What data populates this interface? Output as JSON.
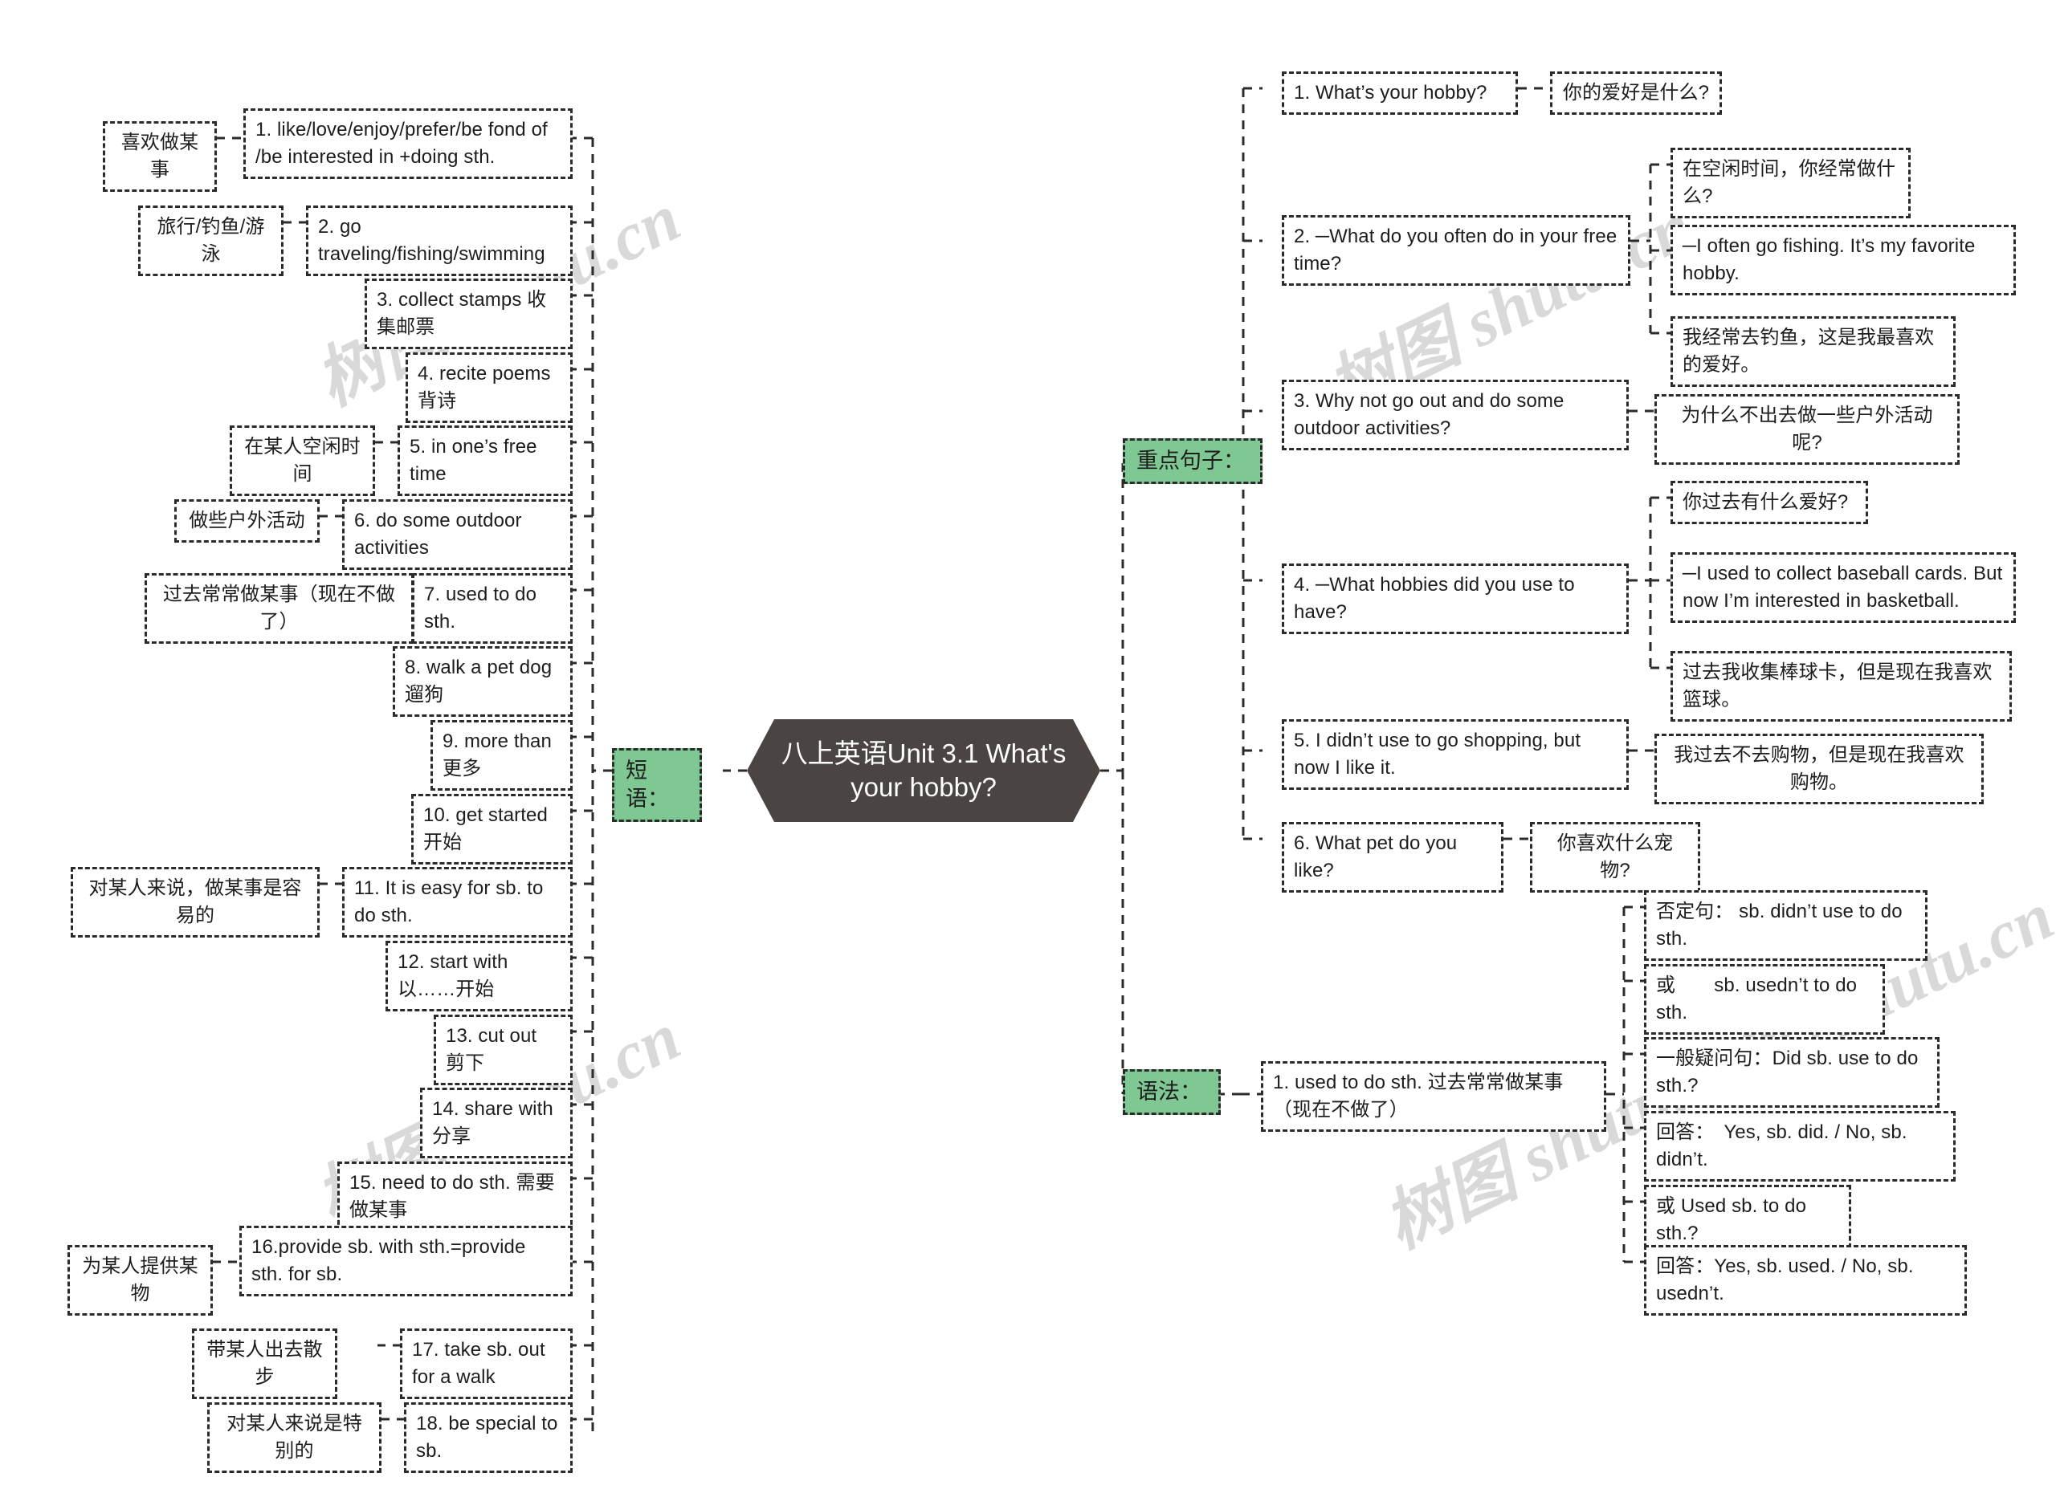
{
  "root": {
    "title": "八上英语Unit 3.1 What's your hobby?"
  },
  "watermarks": [
    "树图 shutu.cn",
    "树图 shutu.cn",
    "树图 shutu.cn",
    "树图 shutu.cn",
    "树图 shutu.cn"
  ],
  "branches": {
    "phrases": {
      "label": "短语：",
      "items": [
        {
          "en": "1. like/love/enjoy/prefer/be fond of /be interested in +doing sth.",
          "zh": "喜欢做某事"
        },
        {
          "en": "2. go traveling/fishing/swimming",
          "zh": "旅行/钓鱼/游泳"
        },
        {
          "en": "3. collect stamps 收集邮票",
          "zh": ""
        },
        {
          "en": "4. recite poems 背诗",
          "zh": ""
        },
        {
          "en": "5. in one’s free time",
          "zh": "在某人空闲时间"
        },
        {
          "en": "6. do some outdoor activities",
          "zh": "做些户外活动"
        },
        {
          "en": "7. used to do sth.",
          "zh": "过去常常做某事（现在不做了）"
        },
        {
          "en": "8. walk a pet dog 遛狗",
          "zh": ""
        },
        {
          "en": "9. more than 更多",
          "zh": ""
        },
        {
          "en": "10. get started 开始",
          "zh": ""
        },
        {
          "en": "11. It is easy for sb. to do sth.",
          "zh": "对某人来说，做某事是容易的"
        },
        {
          "en": "12. start with 以……开始",
          "zh": ""
        },
        {
          "en": "13. cut out 剪下",
          "zh": ""
        },
        {
          "en": "14. share with 分享",
          "zh": ""
        },
        {
          "en": "15. need to do sth. 需要做某事",
          "zh": ""
        },
        {
          "en": "16.provide sb. with sth.=provide sth. for sb.",
          "zh": "为某人提供某物"
        },
        {
          "en": "17. take sb. out for a walk",
          "zh": "带某人出去散步"
        },
        {
          "en": "18. be special to sb.",
          "zh": "对某人来说是特别的"
        }
      ]
    },
    "sentences": {
      "label": "重点句子：",
      "items": [
        {
          "en": "1. What’s your hobby?",
          "children": [
            "你的爱好是什么?"
          ]
        },
        {
          "en": "2. ─What do you often do in your free time?",
          "children": [
            "在空闲时间，你经常做什么?",
            "─I often go fishing. It’s my favorite hobby.",
            "我经常去钓鱼，这是我最喜欢的爱好。"
          ]
        },
        {
          "en": "3. Why not go out and do some outdoor activities?",
          "children": [
            "为什么不出去做一些户外活动呢?"
          ]
        },
        {
          "en": "4. ─What hobbies did you use to have?",
          "children": [
            "你过去有什么爱好?",
            "─I used to collect baseball cards. But now I’m interested in basketball.",
            "过去我收集棒球卡，但是现在我喜欢篮球。"
          ]
        },
        {
          "en": "5. I didn’t use to go shopping, but now I like it.",
          "children": [
            "我过去不去购物，但是现在我喜欢购物。"
          ]
        },
        {
          "en": "6. What pet do you like?",
          "children": [
            "你喜欢什么宠物?"
          ]
        }
      ]
    },
    "grammar": {
      "label": "语法：",
      "items": [
        {
          "en": "1. used to do sth. 过去常常做某事（现在不做了）",
          "children": [
            "否定句： sb. didn’t use to do sth.",
            "或　　sb. usedn’t to do sth.",
            "一般疑问句：Did sb. use to do sth.?",
            "回答：　Yes, sb. did. / No, sb. didn’t.",
            "或 Used sb. to do sth.?",
            "回答：Yes, sb. used. / No, sb. usedn’t."
          ]
        }
      ]
    }
  },
  "colors": {
    "branch_green": "#7fc894",
    "root_bg": "#4a4442",
    "line": "#2b2b2b",
    "watermark": "#d9d9d9"
  }
}
